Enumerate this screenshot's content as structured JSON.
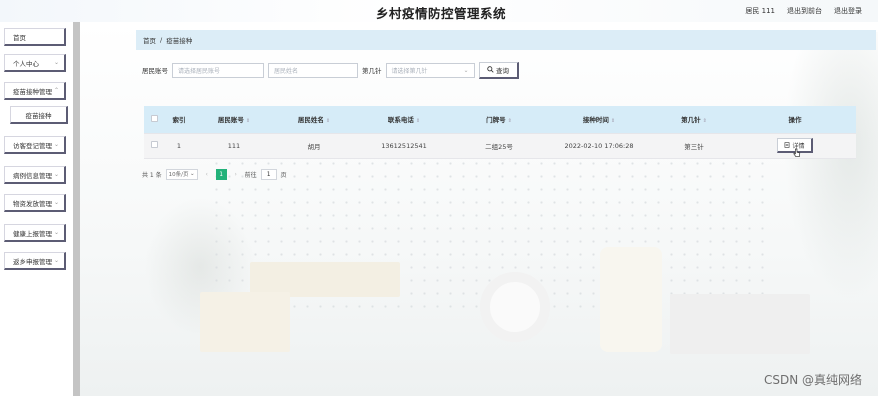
{
  "header": {
    "title": "乡村疫情防控管理系统",
    "links": [
      "居民 111",
      "退出到前台",
      "退出登录"
    ]
  },
  "sidebar": {
    "items": [
      {
        "label": "首页",
        "chevron": false,
        "sub": false
      },
      {
        "label": "个人中心",
        "chevron": true,
        "sub": false
      },
      {
        "label": "疫苗接种管理",
        "chevron": true,
        "sub": false
      },
      {
        "label": "疫苗接种",
        "chevron": false,
        "sub": true
      },
      {
        "label": "访客登记管理",
        "chevron": true,
        "sub": false
      },
      {
        "label": "病例信息管理",
        "chevron": true,
        "sub": false
      },
      {
        "label": "物资发放管理",
        "chevron": true,
        "sub": false
      },
      {
        "label": "健康上报管理",
        "chevron": true,
        "sub": false
      },
      {
        "label": "返乡申报管理",
        "chevron": true,
        "sub": false
      }
    ]
  },
  "breadcrumb": {
    "home": "首页",
    "sep": "/",
    "current": "疫苗接种"
  },
  "search": {
    "label_account": "居民账号",
    "placeholder_account": "请选择居民账号",
    "placeholder_name": "居民姓名",
    "label_dose": "第几针",
    "placeholder_dose": "请选择第几针",
    "button": "查询"
  },
  "table": {
    "headers": [
      "索引",
      "居民账号",
      "居民姓名",
      "联系电话",
      "门牌号",
      "接种时间",
      "第几针",
      "操作"
    ],
    "rows": [
      {
        "index": "1",
        "account": "111",
        "name": "胡月",
        "phone": "13612512541",
        "door": "二组25号",
        "time": "2022-02-10 17:06:28",
        "dose": "第三针",
        "action": "详情"
      }
    ]
  },
  "pagination": {
    "total": "共 1 条",
    "page_size": "10条/页",
    "current": "1",
    "goto_label": "前往",
    "goto_value": "1",
    "page_suffix": "页"
  },
  "watermark": "CSDN @真纯网络",
  "colors": {
    "accent": "#23b27a",
    "header_bg": "#d6ecf8",
    "breadcrumb_bg": "#dcedf7"
  }
}
